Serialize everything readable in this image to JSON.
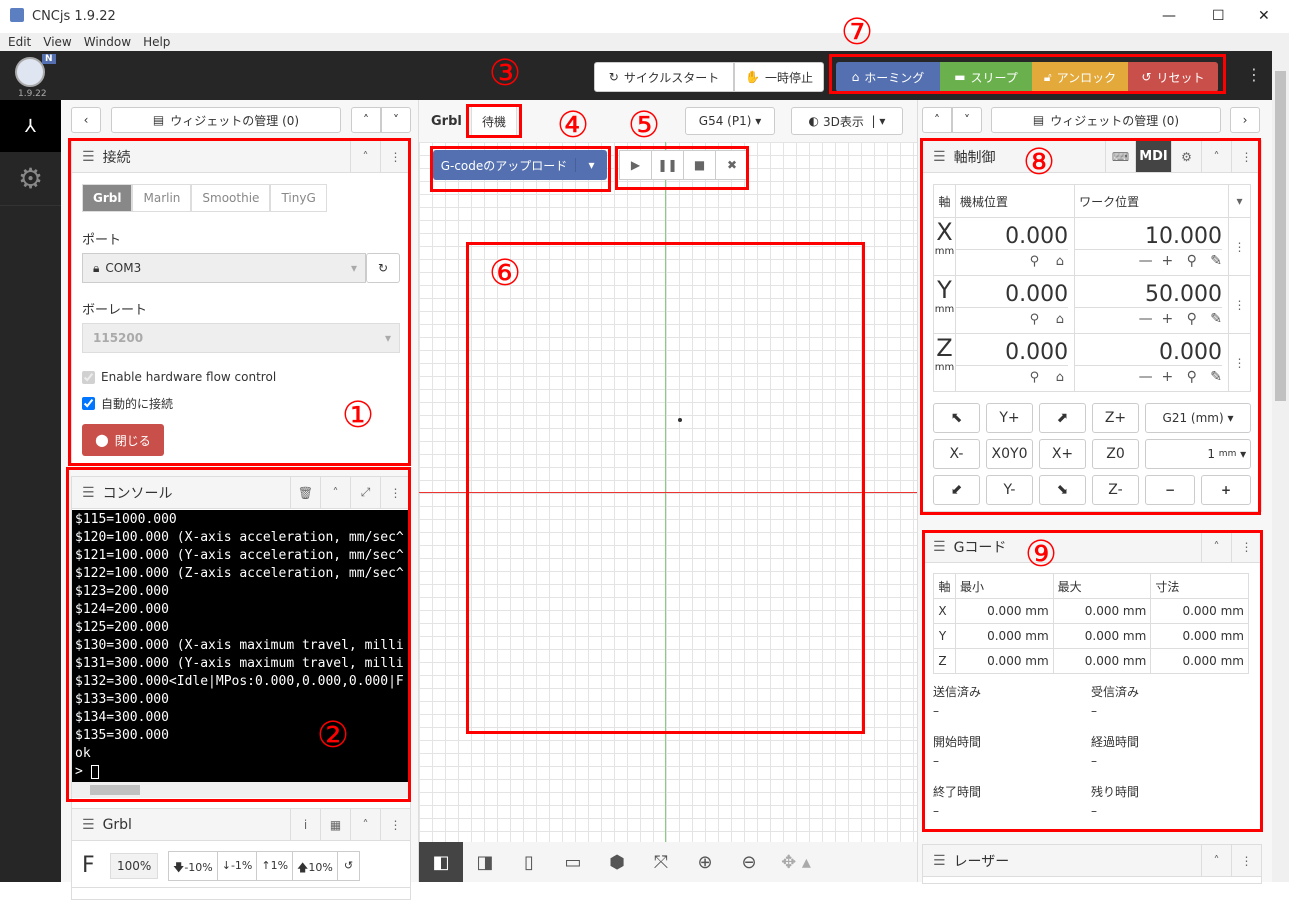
{
  "window": {
    "title": "CNCjs 1.9.22",
    "minimize": "—",
    "maximize": "☐",
    "close": "✕"
  },
  "menu": [
    "Edit",
    "View",
    "Window",
    "Help"
  ],
  "header": {
    "version": "1.9.22",
    "badge": "N",
    "cycle_start": "サイクルスタート",
    "feed_hold": "一時停止",
    "homing": "ホーミング",
    "sleep": "スリープ",
    "unlock": "アンロック",
    "reset": "リセット",
    "colors": {
      "homing": "#5470b0",
      "sleep": "#6ab04c",
      "unlock": "#e3a93b",
      "reset": "#c9504a"
    }
  },
  "left": {
    "manage_widgets": "ウィジェットの管理 (0)",
    "connection": {
      "title": "接続",
      "tabs": [
        "Grbl",
        "Marlin",
        "Smoothie",
        "TinyG"
      ],
      "port_label": "ポート",
      "port": "COM3",
      "baud_label": "ボーレート",
      "baud": "115200",
      "flow_control": "Enable hardware flow control",
      "auto_connect": "自動的に接続",
      "close": "閉じる"
    },
    "console": {
      "title": "コンソール",
      "lines": [
        "$115=1000.000",
        "$120=100.000 (X-axis acceleration, mm/sec^",
        "$121=100.000 (Y-axis acceleration, mm/sec^",
        "$122=100.000 (Z-axis acceleration, mm/sec^",
        "$123=200.000",
        "$124=200.000",
        "$125=200.000",
        "$130=300.000 (X-axis maximum travel, milli",
        "$131=300.000 (Y-axis maximum travel, milli",
        "$132=300.000<Idle|MPos:0.000,0.000,0.000|F",
        "$133=300.000",
        "$134=300.000",
        "$135=300.000",
        "ok",
        "> "
      ]
    },
    "grbl": {
      "title": "Grbl",
      "f": "F",
      "pct": "100%",
      "buttons": [
        "-10%",
        "-1%",
        "1%",
        "10%"
      ]
    }
  },
  "center": {
    "controller": "Grbl",
    "state": "待機",
    "wcs": "G54 (P1)",
    "view3d": "3D表示",
    "upload": "G-codeのアップロード"
  },
  "right": {
    "manage_widgets": "ウィジェットの管理 (0)",
    "axes": {
      "title": "軸制御",
      "mdi": "MDI",
      "headers": [
        "軸",
        "機械位置",
        "ワーク位置"
      ],
      "rows": [
        {
          "axis": "X",
          "unit": "mm",
          "machine": "0.000",
          "work": "10.000"
        },
        {
          "axis": "Y",
          "unit": "mm",
          "machine": "0.000",
          "work": "50.000"
        },
        {
          "axis": "Z",
          "unit": "mm",
          "machine": "0.000",
          "work": "0.000"
        }
      ],
      "jog": [
        "Y+",
        "Z+",
        "X-",
        "X0Y0",
        "X+",
        "Z0",
        "Y-",
        "Z-"
      ],
      "units": "G21 (mm)",
      "step": "1",
      "step_unit": "mm"
    },
    "gcode": {
      "title": "Gコード",
      "headers": [
        "軸",
        "最小",
        "最大",
        "寸法"
      ],
      "rows": [
        [
          "X",
          "0.000 mm",
          "0.000 mm",
          "0.000 mm"
        ],
        [
          "Y",
          "0.000 mm",
          "0.000 mm",
          "0.000 mm"
        ],
        [
          "Z",
          "0.000 mm",
          "0.000 mm",
          "0.000 mm"
        ]
      ],
      "stats": [
        {
          "label": "送信済み",
          "value": "–"
        },
        {
          "label": "受信済み",
          "value": "–"
        },
        {
          "label": "開始時間",
          "value": "–"
        },
        {
          "label": "経過時間",
          "value": "–"
        },
        {
          "label": "終了時間",
          "value": "–"
        },
        {
          "label": "残り時間",
          "value": "–"
        }
      ]
    },
    "laser": {
      "title": "レーザー"
    }
  },
  "annotations": [
    "①",
    "②",
    "③",
    "④",
    "⑤",
    "⑥",
    "⑦",
    "⑧",
    "⑨"
  ]
}
